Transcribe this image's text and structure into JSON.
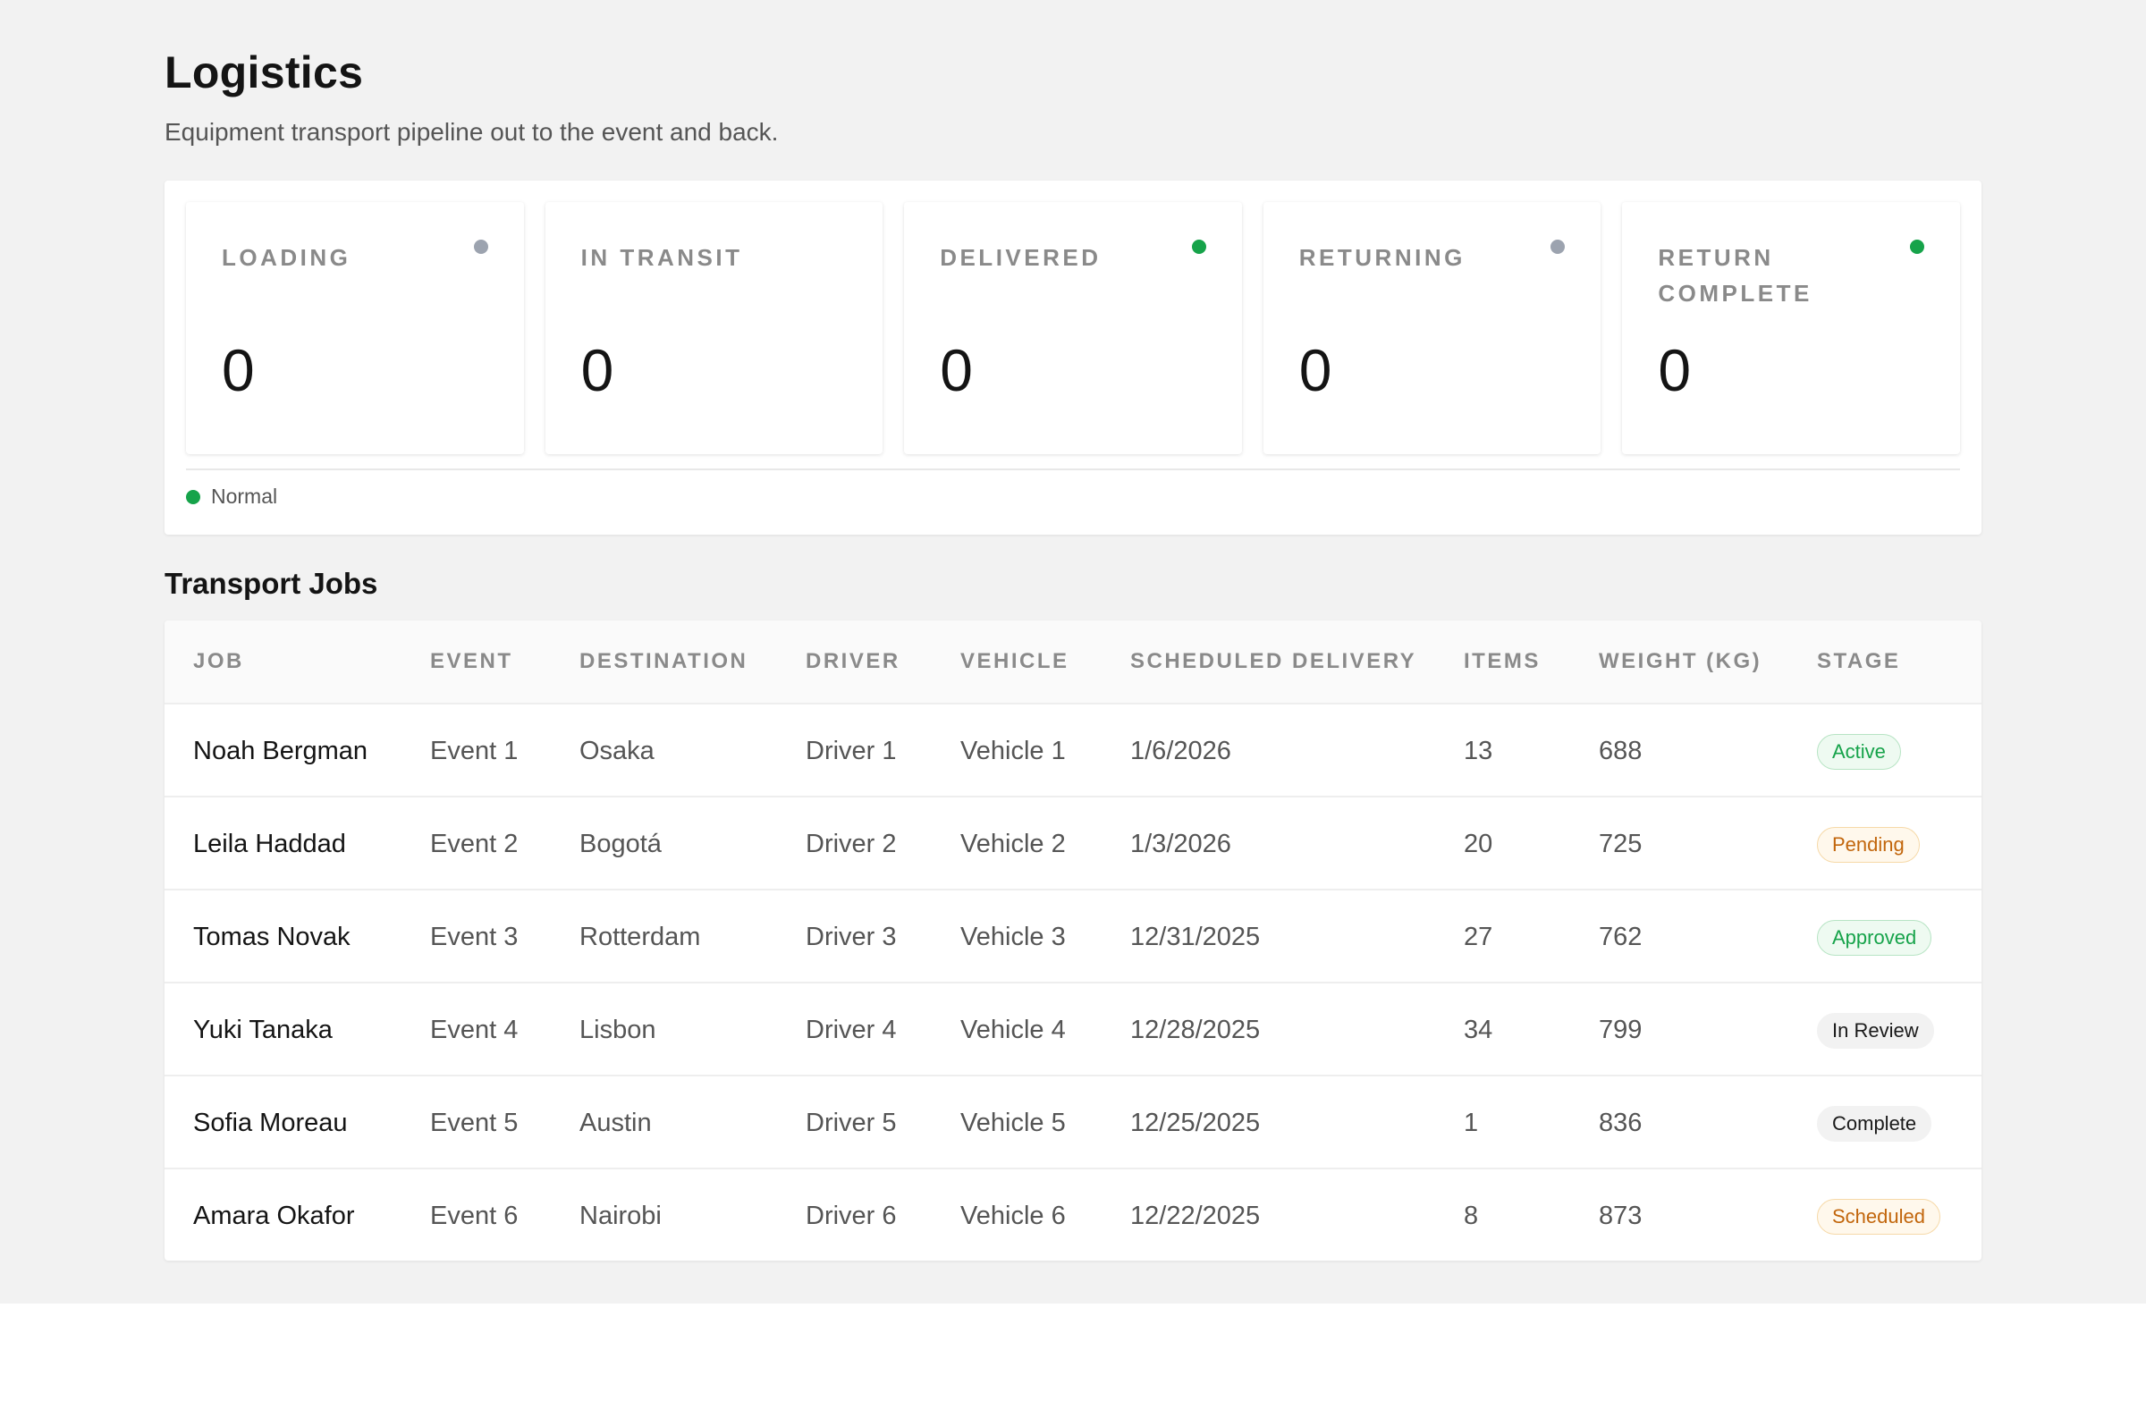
{
  "header": {
    "title": "Logistics",
    "subtitle": "Equipment transport pipeline out to the event and back."
  },
  "pipeline": {
    "stages": [
      {
        "label": "LOADING",
        "count": "0",
        "dot_color": "#9ca3af"
      },
      {
        "label": "IN TRANSIT",
        "count": "0",
        "dot_color": ""
      },
      {
        "label": "DELIVERED",
        "count": "0",
        "dot_color": "#16a34a"
      },
      {
        "label": "RETURNING",
        "count": "0",
        "dot_color": "#9ca3af"
      },
      {
        "label": "RETURN COMPLETE",
        "count": "0",
        "dot_color": "#16a34a"
      }
    ],
    "legend": {
      "label": "Normal",
      "color": "#16a34a"
    }
  },
  "jobs": {
    "title": "Transport Jobs",
    "columns": [
      "JOB",
      "EVENT",
      "DESTINATION",
      "DRIVER",
      "VEHICLE",
      "SCHEDULED DELIVERY",
      "ITEMS",
      "WEIGHT (KG)",
      "STAGE"
    ],
    "rows": [
      {
        "job": "Noah Bergman",
        "event": "Event 1",
        "destination": "Osaka",
        "driver": "Driver 1",
        "vehicle": "Vehicle 1",
        "scheduled": "1/6/2026",
        "items": "13",
        "weight": "688",
        "stage": "Active",
        "tone": "green"
      },
      {
        "job": "Leila Haddad",
        "event": "Event 2",
        "destination": "Bogotá",
        "driver": "Driver 2",
        "vehicle": "Vehicle 2",
        "scheduled": "1/3/2026",
        "items": "20",
        "weight": "725",
        "stage": "Pending",
        "tone": "orange"
      },
      {
        "job": "Tomas Novak",
        "event": "Event 3",
        "destination": "Rotterdam",
        "driver": "Driver 3",
        "vehicle": "Vehicle 3",
        "scheduled": "12/31/2025",
        "items": "27",
        "weight": "762",
        "stage": "Approved",
        "tone": "green"
      },
      {
        "job": "Yuki Tanaka",
        "event": "Event 4",
        "destination": "Lisbon",
        "driver": "Driver 4",
        "vehicle": "Vehicle 4",
        "scheduled": "12/28/2025",
        "items": "34",
        "weight": "799",
        "stage": "In Review",
        "tone": "gray"
      },
      {
        "job": "Sofia Moreau",
        "event": "Event 5",
        "destination": "Austin",
        "driver": "Driver 5",
        "vehicle": "Vehicle 5",
        "scheduled": "12/25/2025",
        "items": "1",
        "weight": "836",
        "stage": "Complete",
        "tone": "gray"
      },
      {
        "job": "Amara Okafor",
        "event": "Event 6",
        "destination": "Nairobi",
        "driver": "Driver 6",
        "vehicle": "Vehicle 6",
        "scheduled": "12/22/2025",
        "items": "8",
        "weight": "873",
        "stage": "Scheduled",
        "tone": "orange"
      }
    ]
  }
}
